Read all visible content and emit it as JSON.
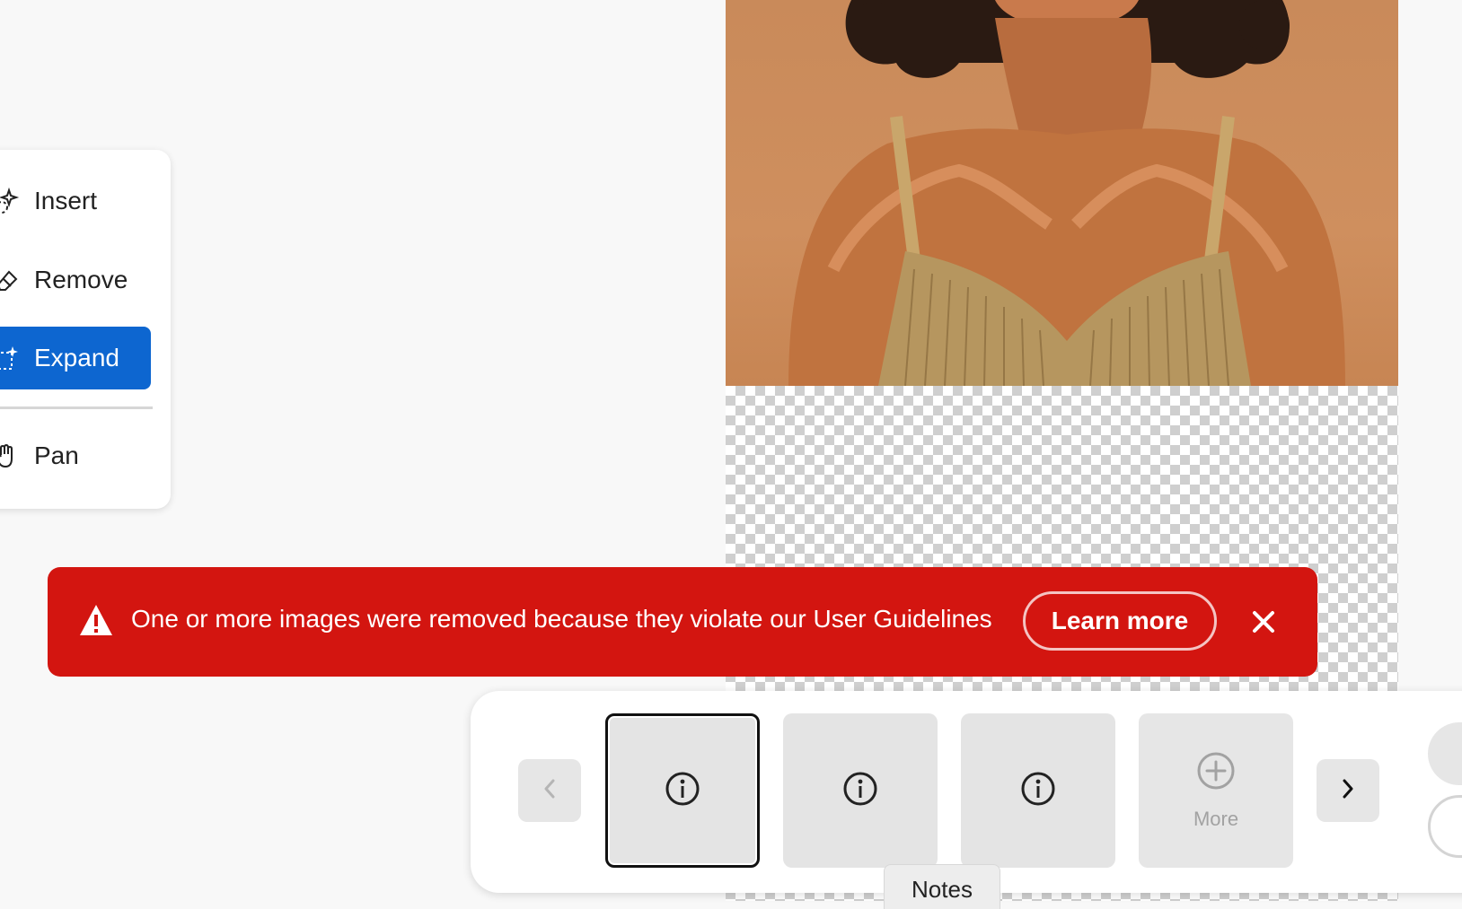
{
  "tools": {
    "items": [
      {
        "label": "Insert",
        "icon": "insert-sparkle-icon",
        "active": false
      },
      {
        "label": "Remove",
        "icon": "eraser-icon",
        "active": false
      },
      {
        "label": "Expand",
        "icon": "expand-sparkle-icon",
        "active": true
      },
      {
        "label": "Pan",
        "icon": "hand-icon",
        "active": false
      }
    ]
  },
  "toast": {
    "message": "One or more images were removed because they violate our User Guidelines",
    "learn_more_label": "Learn more",
    "icon": "warning-triangle-icon",
    "close_icon": "close-icon",
    "color": "#d31510"
  },
  "variants": {
    "thumbnails": [
      {
        "icon": "info-icon",
        "selected": true
      },
      {
        "icon": "info-icon",
        "selected": false
      },
      {
        "icon": "info-icon",
        "selected": false
      }
    ],
    "more_label": "More",
    "more_icon": "plus-circle-icon",
    "prev_icon": "chevron-left-icon",
    "next_icon": "chevron-right-icon"
  },
  "notes_tab_label": "Notes",
  "colors": {
    "accent": "#0d66d0",
    "error": "#d31510"
  }
}
